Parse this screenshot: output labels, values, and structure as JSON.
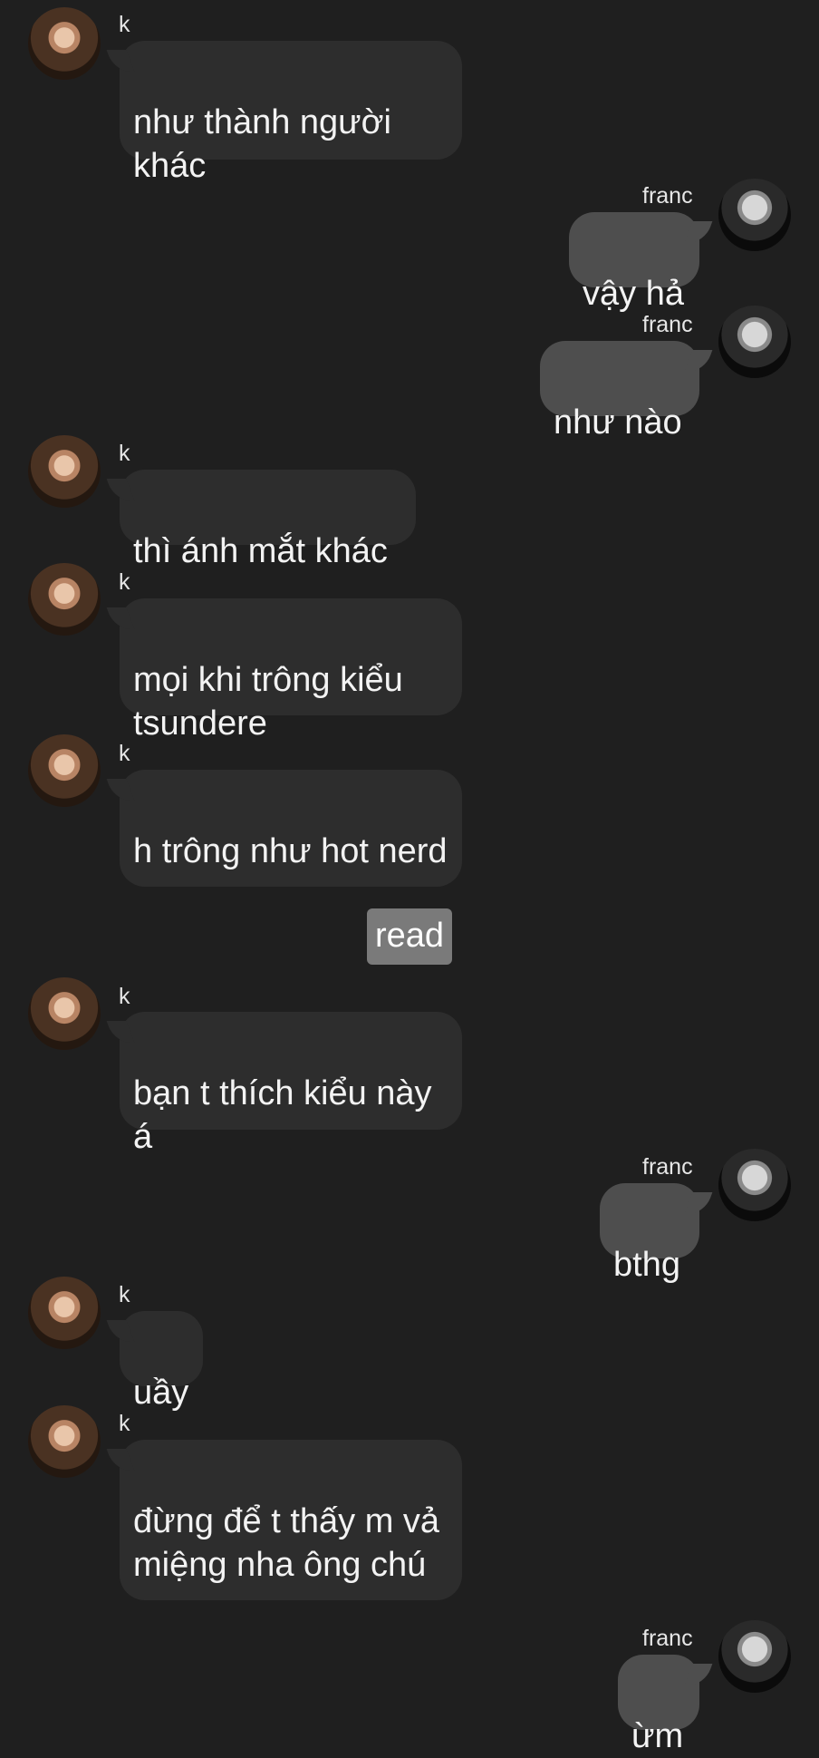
{
  "conversation": {
    "participants": {
      "k": {
        "name": "k"
      },
      "franc": {
        "name": "franc"
      }
    },
    "messages": [
      {
        "sender": "k",
        "text": "như thành người khác"
      },
      {
        "sender": "franc",
        "text": "vậy hả"
      },
      {
        "sender": "franc",
        "text": "như nào"
      },
      {
        "sender": "k",
        "text": "thì ánh mắt khác"
      },
      {
        "sender": "k",
        "text": "mọi khi trông kiểu tsundere"
      },
      {
        "sender": "k",
        "text": "h trông như hot nerd"
      },
      {
        "sender": "k",
        "text": "bạn t thích kiểu này á"
      },
      {
        "sender": "franc",
        "text": "bthg"
      },
      {
        "sender": "k",
        "text": "uầy"
      },
      {
        "sender": "k",
        "text": "đừng để t thấy m vả miệng nha ông chú"
      },
      {
        "sender": "franc",
        "text": "ừm"
      }
    ],
    "read_label": "read"
  }
}
